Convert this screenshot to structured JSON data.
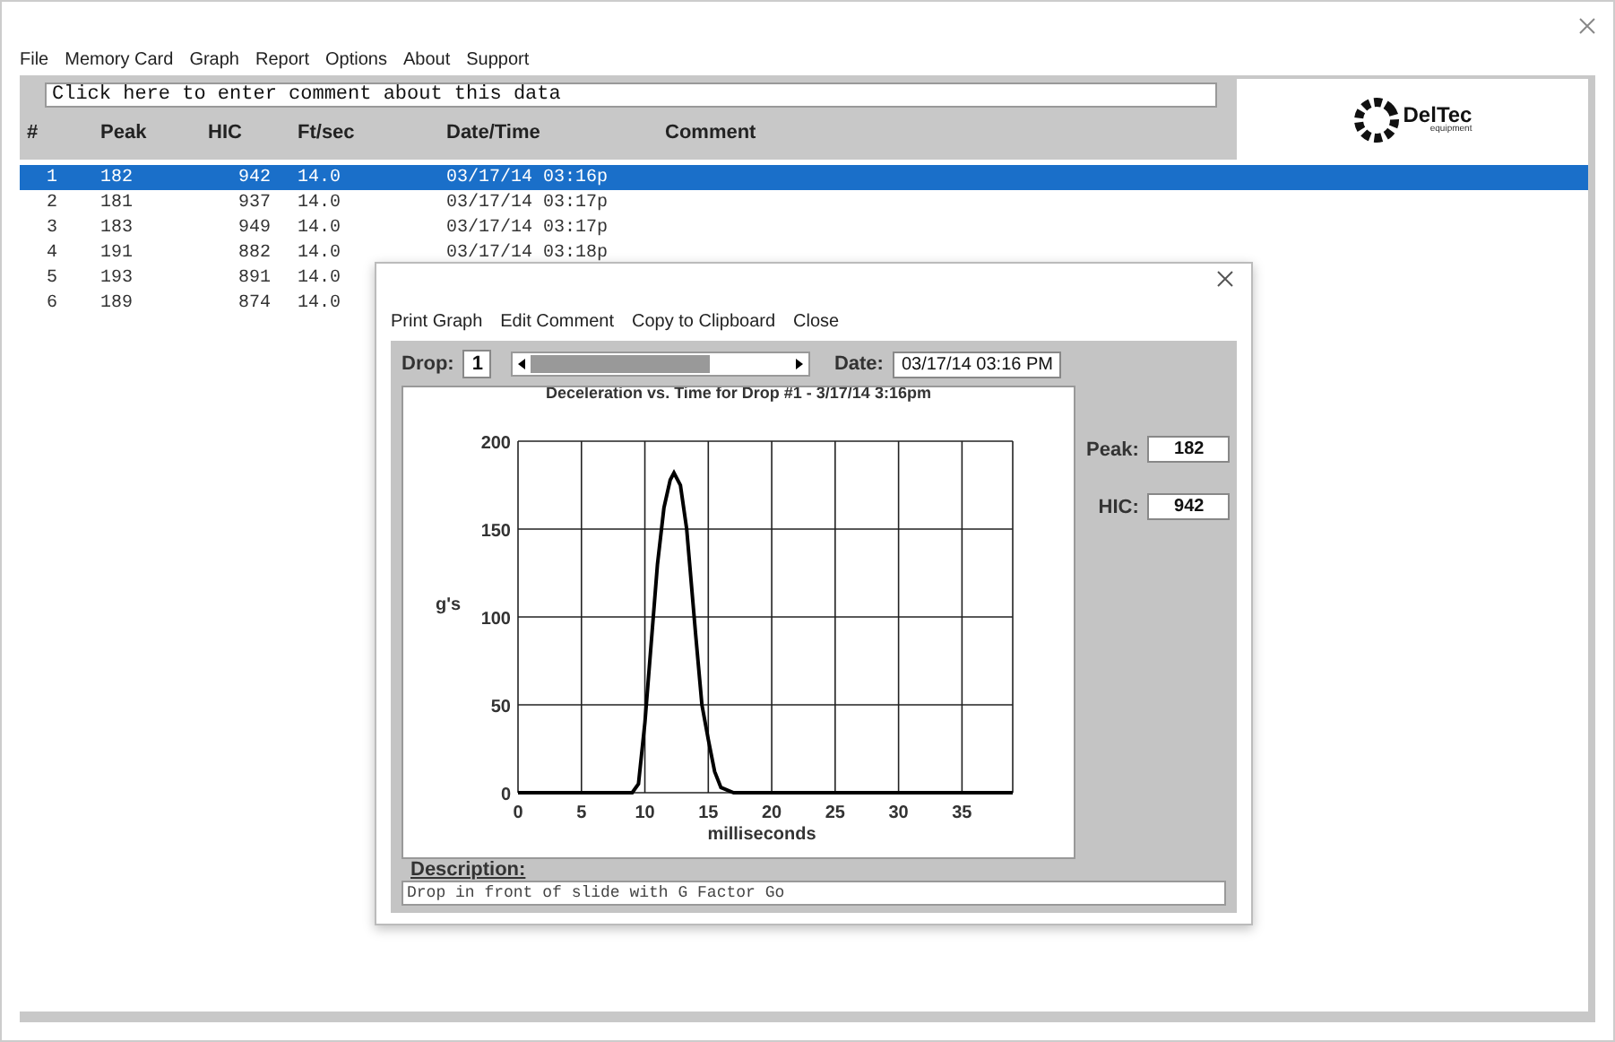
{
  "menu": [
    "File",
    "Memory Card",
    "Graph",
    "Report",
    "Options",
    "About",
    "Support"
  ],
  "comment_field": {
    "value": "Click here to enter comment about this data"
  },
  "logo": {
    "name": "DelTec",
    "tagline": "equipment"
  },
  "table": {
    "columns": [
      "#",
      "Peak",
      "HIC",
      "Ft/sec",
      "Date/Time",
      "Comment"
    ],
    "rows": [
      {
        "cells": [
          "1",
          "182",
          "942",
          "14.0",
          "03/17/14 03:16p"
        ],
        "selected": true
      },
      {
        "cells": [
          "2",
          "181",
          "937",
          "14.0",
          "03/17/14 03:17p"
        ],
        "selected": false
      },
      {
        "cells": [
          "3",
          "183",
          "949",
          "14.0",
          "03/17/14 03:17p"
        ],
        "selected": false
      },
      {
        "cells": [
          "4",
          "191",
          "882",
          "14.0",
          "03/17/14 03:18p"
        ],
        "selected": false
      },
      {
        "cells": [
          "5",
          "193",
          "891",
          "14.0"
        ],
        "selected": false
      },
      {
        "cells": [
          "6",
          "189",
          "874",
          "14.0"
        ],
        "selected": false
      }
    ]
  },
  "dialog": {
    "menu": [
      "Print Graph",
      "Edit Comment",
      "Copy to Clipboard",
      "Close"
    ],
    "drop_label": "Drop:",
    "drop_value": "1",
    "date_label": "Date:",
    "date_value": "03/17/14 03:16 PM",
    "peak_label": "Peak:",
    "peak_value": "182",
    "hic_label": "HIC:",
    "hic_value": "942",
    "description_label": "Description:",
    "description_value": "Drop in front of slide with G Factor Go",
    "chart_data": {
      "type": "line",
      "title": "Deceleration vs. Time for Drop #1 - 3/17/14 3:16pm",
      "xlabel": "milliseconds",
      "ylabel": "g's",
      "x": [
        0,
        5,
        9,
        9.5,
        10,
        10.5,
        11,
        11.5,
        12,
        12.3,
        12.8,
        13.3,
        14,
        14.5,
        15,
        15.5,
        16,
        17,
        25,
        39
      ],
      "grid": true,
      "series": [
        {
          "color": "#000000",
          "values": [
            0,
            0,
            0,
            5,
            40,
            85,
            130,
            162,
            178,
            182,
            175,
            150,
            90,
            50,
            30,
            12,
            3,
            0,
            0,
            0
          ]
        }
      ],
      "xlim": [
        0,
        39
      ],
      "ylim": [
        0,
        200
      ],
      "xticks": [
        0,
        5,
        10,
        15,
        20,
        25,
        30,
        35
      ],
      "yticks": [
        0,
        50,
        100,
        150,
        200
      ]
    }
  }
}
